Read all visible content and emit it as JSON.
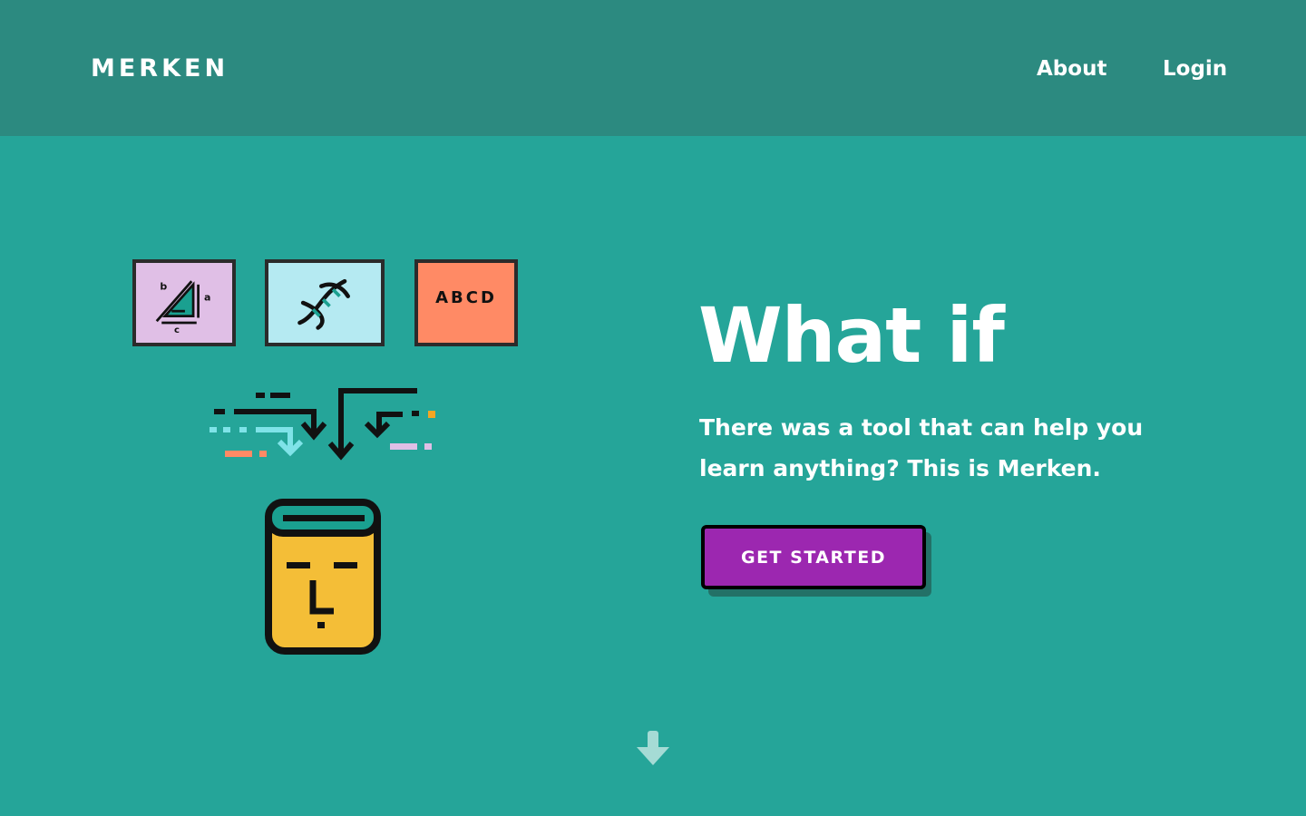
{
  "header": {
    "logo": "MERKEN",
    "nav": [
      {
        "label": "About"
      },
      {
        "label": "Login"
      }
    ]
  },
  "illustration": {
    "cards": [
      {
        "icon": "triangle-geometry-icon",
        "color": "#e0bfe6"
      },
      {
        "icon": "dna-icon",
        "color": "#b5eaf2"
      },
      {
        "icon": "abcd-letters-icon",
        "color": "#ff8a65",
        "text": "ABCD"
      }
    ],
    "book_icon": "book-face-icon",
    "arrows_icon": "merging-arrows-icon"
  },
  "hero": {
    "headline": "What if",
    "subtext": "There was a tool that can help you learn anything? This is Merken.",
    "cta_label": "GET STARTED"
  },
  "scroll_hint_icon": "arrow-down-icon",
  "colors": {
    "background": "#25a599",
    "topbar": "#2c8a80",
    "cta": "#9c27b0",
    "book": "#f4be37"
  }
}
